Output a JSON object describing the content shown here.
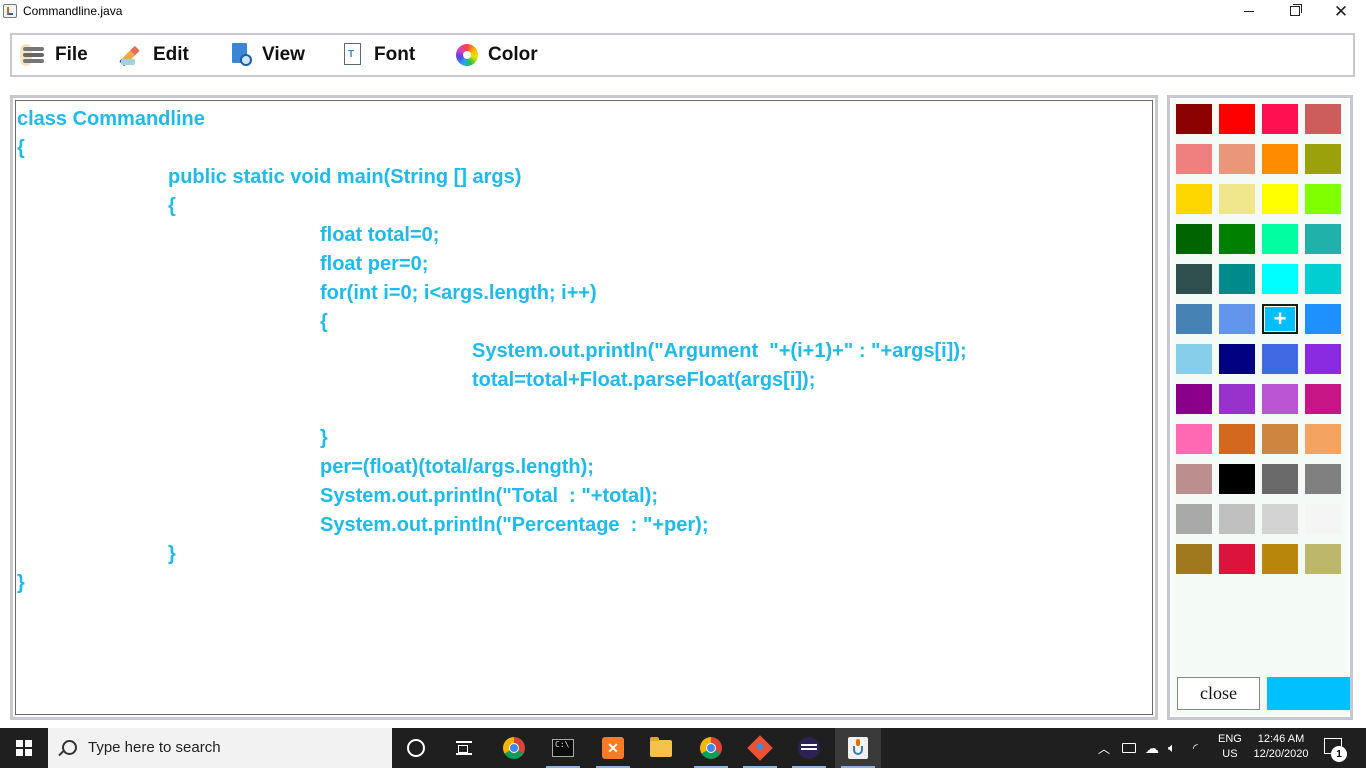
{
  "window": {
    "title": "Commandline.java",
    "controls": {
      "minimize": "minimize",
      "maximize": "maximize",
      "close": "close"
    }
  },
  "menu": {
    "items": [
      {
        "label": "File",
        "icon": "hamburger-icon"
      },
      {
        "label": "Edit",
        "icon": "pencil-icon"
      },
      {
        "label": "View",
        "icon": "document-search-icon"
      },
      {
        "label": "Font",
        "icon": "font-document-icon"
      },
      {
        "label": "Color",
        "icon": "color-wheel-icon"
      }
    ]
  },
  "editor": {
    "text_color": "#1fbaec",
    "lines": [
      {
        "indent": 0,
        "text": "class Commandline"
      },
      {
        "indent": 0,
        "text": "{"
      },
      {
        "indent": 1,
        "text": "public static void main(String [] args)"
      },
      {
        "indent": 1,
        "text": "{"
      },
      {
        "indent": 2,
        "text": "float total=0;"
      },
      {
        "indent": 2,
        "text": "float per=0;"
      },
      {
        "indent": 2,
        "text": "for(int i=0; i<args.length; i++)"
      },
      {
        "indent": 2,
        "text": "{"
      },
      {
        "indent": 3,
        "text": "System.out.println(\"Argument  \"+(i+1)+\" : \"+args[i]);"
      },
      {
        "indent": 3,
        "text": "total=total+Float.parseFloat(args[i]);"
      },
      {
        "indent": 3,
        "text": ""
      },
      {
        "indent": 2,
        "text": "}"
      },
      {
        "indent": 2,
        "text": "per=(float)(total/args.length);"
      },
      {
        "indent": 2,
        "text": "System.out.println(\"Total  : \"+total);"
      },
      {
        "indent": 2,
        "text": "System.out.println(\"Percentage  : \"+per);"
      },
      {
        "indent": 1,
        "text": "}"
      },
      {
        "indent": 0,
        "text": "}"
      }
    ]
  },
  "palette": {
    "colors": [
      "#8b0000",
      "#ff0000",
      "#ff1050",
      "#cd5c5c",
      "#f08080",
      "#e9967a",
      "#ff8c00",
      "#9aa10a",
      "#ffd700",
      "#f0e68c",
      "#ffff00",
      "#7fff00",
      "#006400",
      "#008000",
      "#00ff9f",
      "#20b2aa",
      "#2f4f4f",
      "#008b8b",
      "#00ffff",
      "#00ced1",
      "#4682b4",
      "#6495ed",
      "#00bfff",
      "#1e90ff",
      "#87ceeb",
      "#000080",
      "#4169e1",
      "#8a2be2",
      "#8b008b",
      "#9932cc",
      "#ba55d3",
      "#c71585",
      "#ff69b4",
      "#d2691e",
      "#cd853f",
      "#f4a460",
      "#bc8f8f",
      "#000000",
      "#696969",
      "#808080",
      "#a9a9a9",
      "#c0c0c0",
      "#d3d3d3",
      "#f5f5f5",
      "#a0781e",
      "#dc143c",
      "#b8860b",
      "#bdb76b"
    ],
    "selected_index": 22,
    "selected_mark": "+",
    "close_label": "close",
    "preview_color": "#00bfff"
  },
  "taskbar": {
    "search_placeholder": "Type here to search",
    "apps": [
      "cortana-icon",
      "task-view-icon",
      "chrome-icon",
      "command-prompt-icon",
      "xampp-icon",
      "file-explorer-icon",
      "chrome-profile-icon",
      "git-icon",
      "eclipse-icon",
      "java-icon"
    ],
    "lang_top": "ENG",
    "lang_bottom": "US",
    "time": "12:46 AM",
    "date": "12/20/2020",
    "notification_count": "1"
  }
}
